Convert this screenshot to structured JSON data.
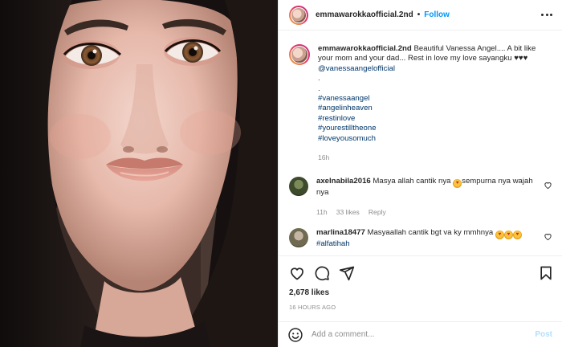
{
  "photo": {
    "alt": "selfie photo"
  },
  "header": {
    "username": "emmawarokkaofficial.2nd",
    "separator": "•",
    "follow_label": "Follow"
  },
  "caption": {
    "username": "emmawarokkaofficial.2nd",
    "text": "Beautiful Vanessa Angel.... A bit like your mom and your dad... Rest in love my love sayangku ♥♥♥",
    "mention": "@vanessaangelofficial",
    "dot1": ".",
    "dot2": ".",
    "hashtags": [
      "#vanessaangel",
      "#angelinheaven",
      "#restinlove",
      "#yourestilltheone",
      "#loveyousomuch"
    ],
    "time": "16h"
  },
  "comments": [
    {
      "username": "axelnabila2016",
      "text_a": "Masya allah cantik nya",
      "text_b": "sempurna nya wajah nya",
      "time": "11h",
      "likes": "33 likes",
      "reply": "Reply"
    },
    {
      "username": "marlina18477",
      "text_a": "Masyaallah cantik bgt va ky mmhnya",
      "text_b": "#alfatihah"
    }
  ],
  "stats": {
    "likes": "2,678 likes",
    "timestamp": "16 HOURS AGO"
  },
  "composer": {
    "placeholder": "Add a comment...",
    "post_label": "Post"
  },
  "colors": {
    "accent": "#0095f6",
    "link": "#00376b",
    "muted": "#8e8e8e",
    "post_disabled": "#b2dffc"
  },
  "icons": [
    "more-icon",
    "like-icon",
    "comment-icon",
    "share-icon",
    "save-icon",
    "emoji-icon"
  ]
}
